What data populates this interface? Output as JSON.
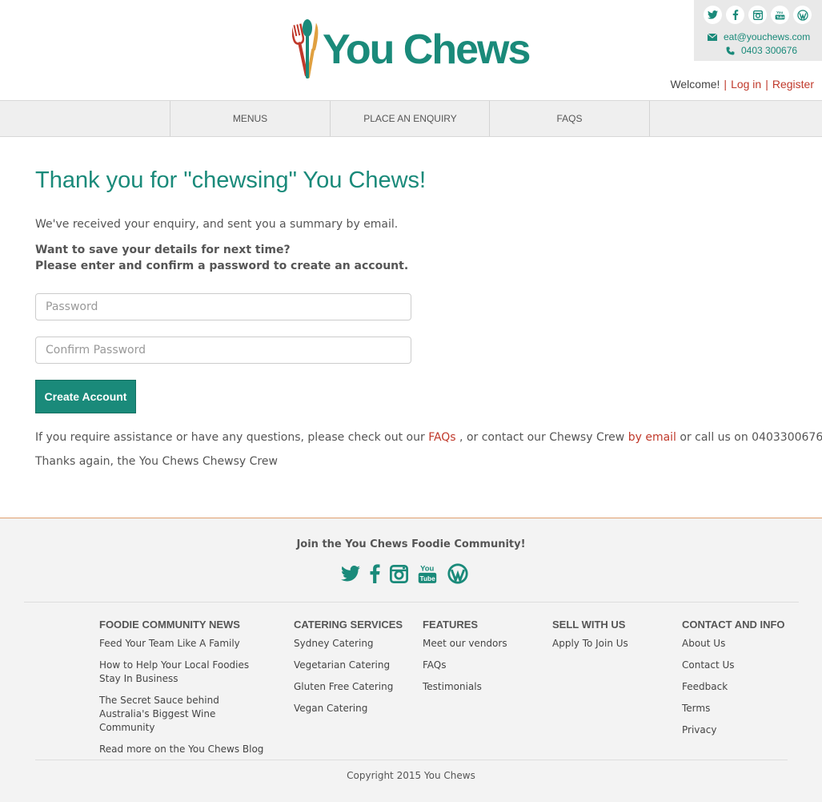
{
  "brand": {
    "name": "You Chews",
    "color": "#1a8a7a",
    "accent": "#c0392b"
  },
  "header": {
    "social_icons": [
      "twitter-icon",
      "facebook-icon",
      "instagram-icon",
      "youtube-icon",
      "wordpress-icon"
    ],
    "email": "eat@youchews.com",
    "phone": "0403 300676",
    "welcome": "Welcome!",
    "login": "Log in",
    "register": "Register"
  },
  "nav": {
    "items": [
      {
        "label": "MENUS"
      },
      {
        "label": "PLACE AN ENQUIRY"
      },
      {
        "label": "FAQS"
      }
    ]
  },
  "main": {
    "title": "Thank you for \"chewsing\" You Chews!",
    "received": "We've received your enquiry, and sent you a summary by email.",
    "save_line1": "Want to save your details for next time?",
    "save_line2": "Please enter and confirm a password to create an account.",
    "password_placeholder": "Password",
    "confirm_placeholder": "Confirm Password",
    "create_button": "Create Account",
    "help_prefix": "If you require assistance or have any questions, please check out our ",
    "help_faqs": "FAQs",
    "help_middle": " , or contact our Chewsy Crew ",
    "help_email": "by email",
    "help_suffix": " or call us on 0403300676.",
    "thanks": "Thanks again, the You Chews Chewsy Crew"
  },
  "footer": {
    "join": "Join the You Chews Foodie Community!",
    "social_icons": [
      "twitter-icon",
      "facebook-icon",
      "instagram-icon",
      "youtube-icon",
      "wordpress-icon"
    ],
    "columns": [
      {
        "title": "FOODIE COMMUNITY NEWS",
        "links": [
          "Feed Your Team Like A Family",
          "How to Help Your Local Foodies Stay In Business",
          "The Secret Sauce behind Australia's Biggest Wine Community",
          "Read more on the You Chews Blog"
        ]
      },
      {
        "title": "CATERING SERVICES",
        "links": [
          "Sydney Catering",
          "Vegetarian Catering",
          "Gluten Free Catering",
          "Vegan Catering"
        ]
      },
      {
        "title": "FEATURES",
        "links": [
          "Meet our vendors",
          "FAQs",
          "Testimonials"
        ]
      },
      {
        "title": "SELL WITH US",
        "links": [
          "Apply To Join Us"
        ]
      },
      {
        "title": "CONTACT AND INFO",
        "links": [
          "About Us",
          "Contact Us",
          "Feedback",
          "Terms",
          "Privacy"
        ]
      }
    ],
    "copyright": "Copyright 2015 You Chews"
  }
}
